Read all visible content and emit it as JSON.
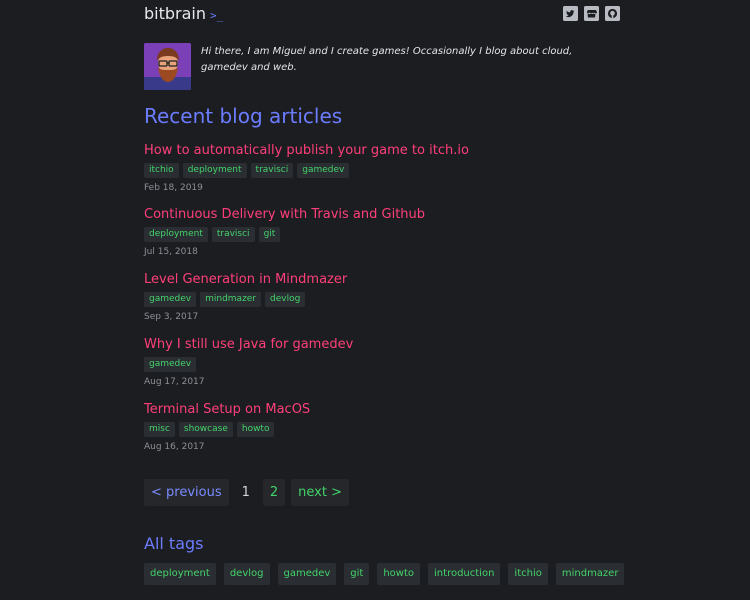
{
  "header": {
    "brand": "bitbrain",
    "prompt": ">_",
    "social": [
      "twitter-icon",
      "itchio-icon",
      "github-icon"
    ]
  },
  "intro": {
    "text": "Hi there, I am Miguel and I create games! Occasionally I blog about cloud, gamedev and web."
  },
  "recent": {
    "title": "Recent blog articles",
    "articles": [
      {
        "title": "How to automatically publish your game to itch.io",
        "tags": [
          "itchio",
          "deployment",
          "travisci",
          "gamedev"
        ],
        "date": "Feb 18, 2019"
      },
      {
        "title": "Continuous Delivery with Travis and Github",
        "tags": [
          "deployment",
          "travisci",
          "git"
        ],
        "date": "Jul 15, 2018"
      },
      {
        "title": "Level Generation in Mindmazer",
        "tags": [
          "gamedev",
          "mindmazer",
          "devlog"
        ],
        "date": "Sep 3, 2017"
      },
      {
        "title": "Why I still use Java for gamedev",
        "tags": [
          "gamedev"
        ],
        "date": "Aug 17, 2017"
      },
      {
        "title": "Terminal Setup on MacOS",
        "tags": [
          "misc",
          "showcase",
          "howto"
        ],
        "date": "Aug 16, 2017"
      }
    ]
  },
  "pagination": {
    "previous": "< previous",
    "page1": "1",
    "page2": "2",
    "next": "next >"
  },
  "alltags": {
    "title": "All tags",
    "tags": [
      "deployment",
      "devlog",
      "gamedev",
      "git",
      "howto",
      "introduction",
      "itchio",
      "mindmazer"
    ]
  },
  "colors": {
    "background": "#1c1d21",
    "accent": "#6b7cff",
    "article_link": "#ff3f7a",
    "tag_text": "#43d36b"
  }
}
